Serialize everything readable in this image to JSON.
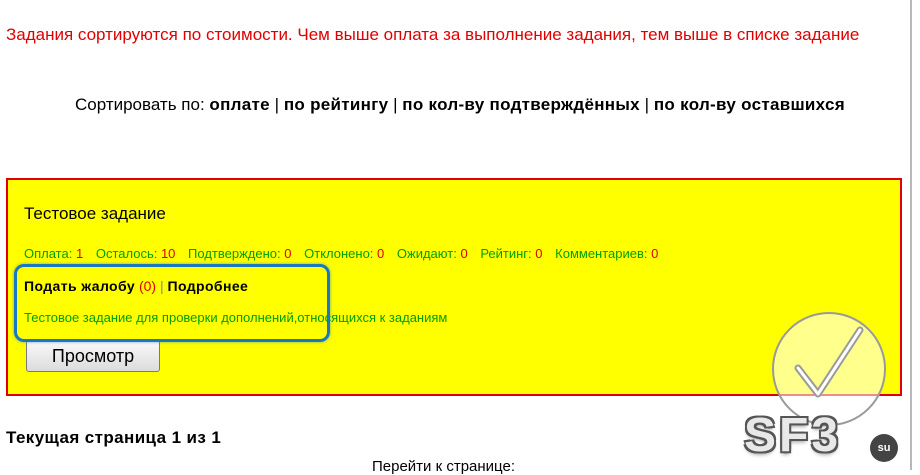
{
  "notice": "Задания сортируются по стоимости. Чем выше оплата за выполнение задания, тем выше в списке задание",
  "sort": {
    "label": "Сортировать по:",
    "options": [
      "оплате",
      "по рейтингу",
      "по кол-ву подтверждённых",
      "по кол-ву оставшихся"
    ],
    "separator": "|"
  },
  "task": {
    "title": "Тестовое задание",
    "stats": [
      {
        "label": "Оплата:",
        "value": "1"
      },
      {
        "label": "Осталось:",
        "value": "10"
      },
      {
        "label": "Подтверждено:",
        "value": "0"
      },
      {
        "label": "Отклонено:",
        "value": "0"
      },
      {
        "label": "Ожидают:",
        "value": "0"
      },
      {
        "label": "Рейтинг:",
        "value": "0"
      },
      {
        "label": "Комментариев:",
        "value": "0"
      }
    ],
    "complaint_label": "Подать жалобу",
    "complaint_count": "(0)",
    "details_label": "Подробнее",
    "description": "Тестовое задание для проверки дополнений,относящихся к заданиям",
    "view_button": "Просмотр"
  },
  "pagination": {
    "current": "Текущая страница 1 из 1",
    "goto": "Перейти к странице:"
  },
  "watermark": {
    "text": "SF3",
    "badge": "su"
  },
  "colors": {
    "accent_red": "#e00000",
    "card_bg": "#ffff00",
    "stat_green": "#00a000",
    "highlight_blue": "#1a78c2"
  },
  "icons": [
    "checkmark-icon"
  ]
}
